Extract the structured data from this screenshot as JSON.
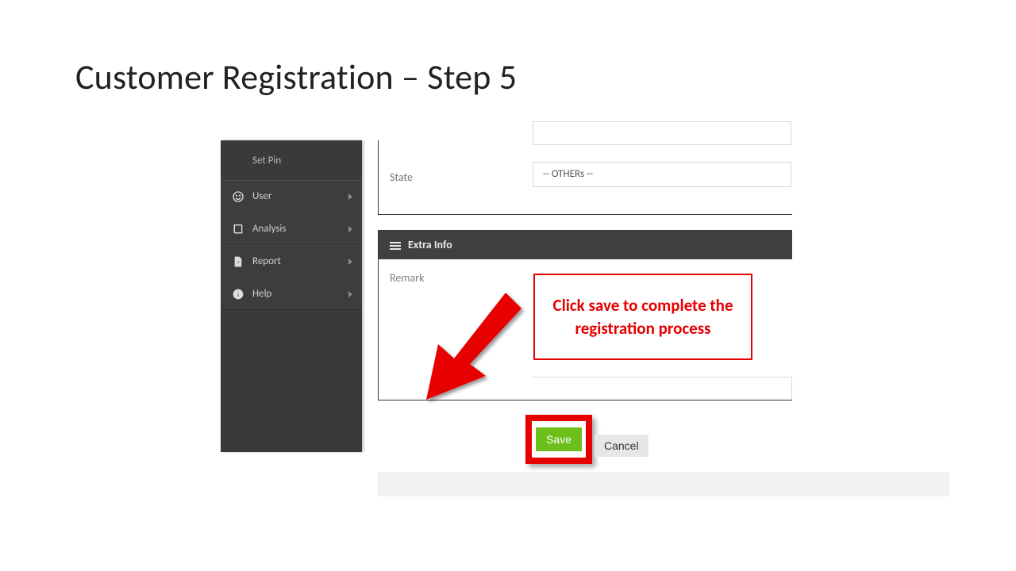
{
  "title": "Customer Registration – Step 5",
  "sidebar": {
    "setpin": "Set Pin",
    "items": [
      {
        "label": "User"
      },
      {
        "label": "Analysis"
      },
      {
        "label": "Report"
      },
      {
        "label": "Help"
      }
    ]
  },
  "form": {
    "state_label": "State",
    "state_value": "-- OTHERs --",
    "extra_info_title": "Extra Info",
    "remark_label": "Remark",
    "save_label": "Save",
    "cancel_label": "Cancel"
  },
  "callout": {
    "text": "Click save to complete the registration process"
  }
}
